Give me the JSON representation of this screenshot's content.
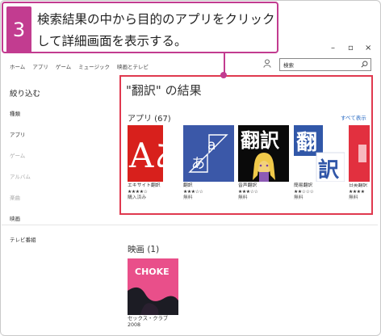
{
  "callout": {
    "step": "3",
    "line1": "検索結果の中から目的のアプリをクリック",
    "line2": "して詳細画面を表示する。"
  },
  "window_controls": {
    "minimize": "–",
    "maximize": "▫",
    "close": "×"
  },
  "nav": {
    "items": [
      "ホーム",
      "アプリ",
      "ゲーム",
      "ミュージック",
      "映画とテレビ"
    ]
  },
  "search": {
    "value": "検索",
    "icon": "search-icon"
  },
  "sidebar": {
    "title": "絞り込む",
    "items": [
      {
        "label": "種類",
        "style": "dark"
      },
      {
        "label": "アプリ",
        "style": "dark"
      },
      {
        "label": "ゲーム",
        "style": "light"
      },
      {
        "label": "アルバム",
        "style": "light"
      },
      {
        "label": "楽曲",
        "style": "light"
      },
      {
        "label": "映画",
        "style": "dark"
      },
      {
        "label": "テレビ番組",
        "style": "dark"
      }
    ]
  },
  "results": {
    "title": "\"翻訳\" の結果",
    "apps_heading": "アプリ (67)",
    "see_all": "すべて表示",
    "apps": [
      {
        "name": "エキサイト翻訳",
        "stars": "★★★★☆",
        "sub": "購入済み"
      },
      {
        "name": "翻訳",
        "stars": "★★★☆☆",
        "sub": "無料"
      },
      {
        "name": "音声翻訳",
        "stars": "★★★☆☆",
        "sub": "無料"
      },
      {
        "name": "簡易翻訳",
        "stars": "★★☆☆☆",
        "sub": "無料"
      },
      {
        "name": "日英翻訳",
        "stars": "★★★★",
        "sub": "無料"
      }
    ],
    "tile_glyphs": {
      "app1": "Aあ",
      "app2_top": "a",
      "app2_bottom": "あ",
      "app3": "翻訳",
      "app4_top": "翻",
      "app4_bottom": "訳"
    }
  },
  "movies": {
    "heading": "映画 (1)",
    "items": [
      {
        "title": "セックス・クラブ",
        "year": "2008",
        "poster_text": "CHOKE"
      }
    ]
  },
  "colors": {
    "callout_accent": "#c23c90",
    "highlight": "#e0394f",
    "link": "#2b6cc4"
  }
}
